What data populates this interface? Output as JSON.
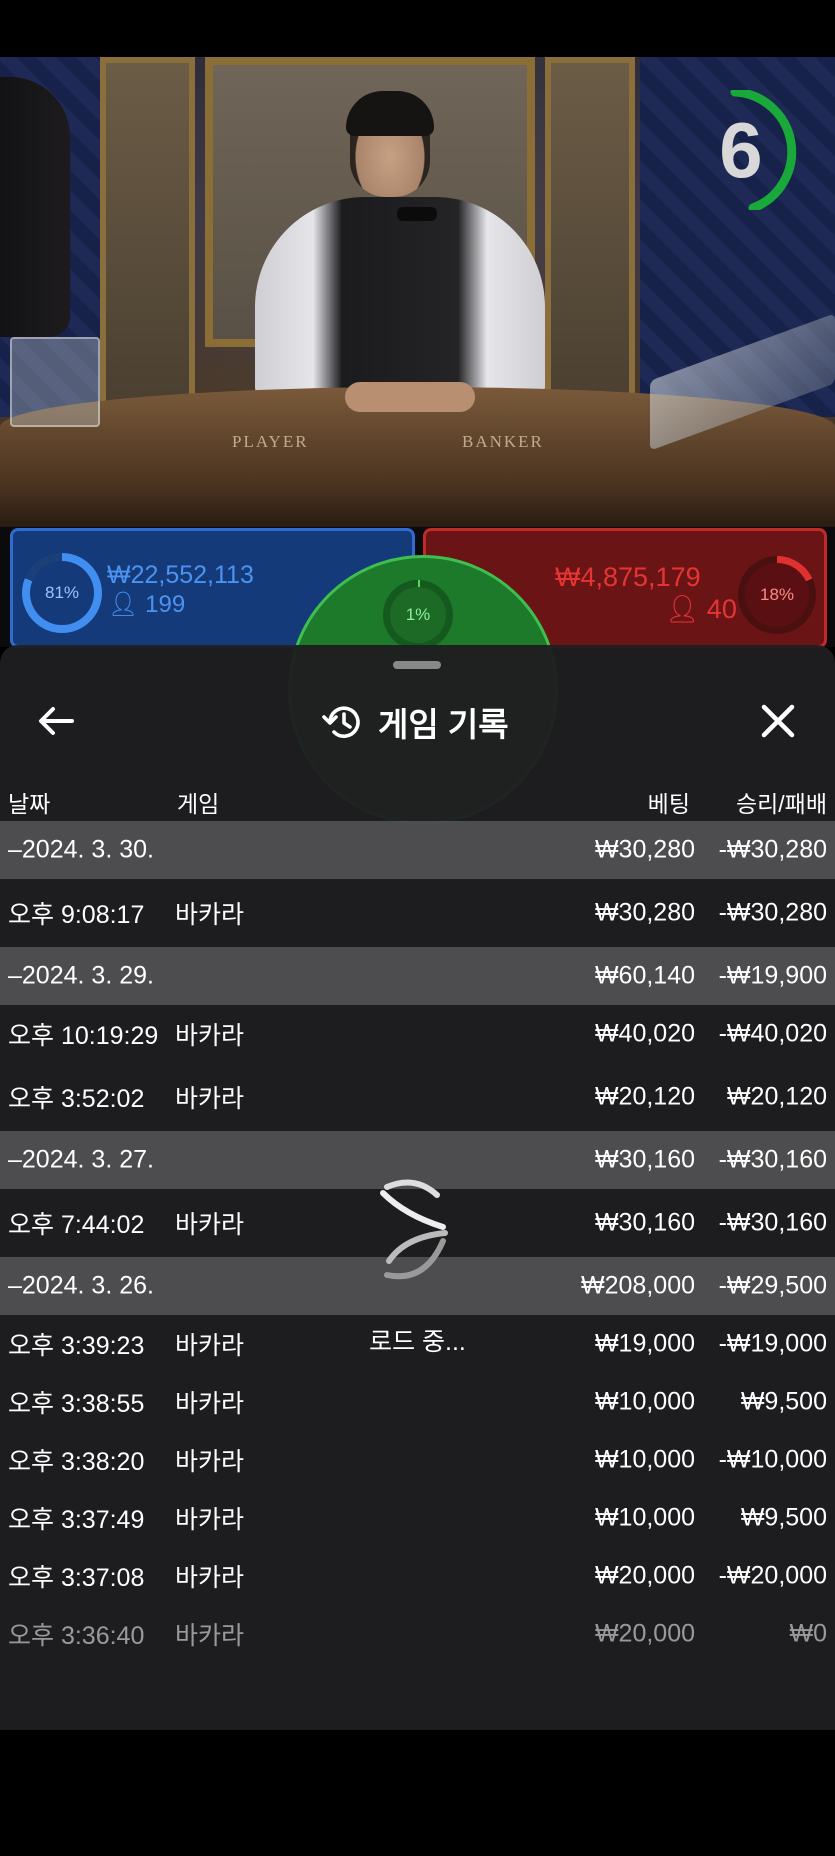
{
  "game": {
    "timer": "6",
    "table_labels": {
      "player": "PLAYER",
      "banker": "BANKER"
    }
  },
  "bets": {
    "player": {
      "percent_label": "81%",
      "percent": 81,
      "amount": "₩22,552,113",
      "players": "199"
    },
    "tie": {
      "percent_label": "1%",
      "percent": 1
    },
    "banker": {
      "percent_label": "18%",
      "percent": 18,
      "amount": "₩4,875,179",
      "players": "40"
    }
  },
  "history": {
    "title": "게임 기록",
    "columns": {
      "date": "날짜",
      "game": "게임",
      "bet": "베팅",
      "win_loss": "승리/패배"
    },
    "rows": [
      {
        "type": "date",
        "date": "–2024. 3. 30.",
        "game": "",
        "bet": "₩30,280",
        "win_loss": "-₩30,280"
      },
      {
        "type": "item",
        "date": "오후 9:08:17",
        "game": "바카라",
        "bet": "₩30,280",
        "win_loss": "-₩30,280"
      },
      {
        "type": "date",
        "date": "–2024. 3. 29.",
        "game": "",
        "bet": "₩60,140",
        "win_loss": "-₩19,900"
      },
      {
        "type": "item",
        "date": "오후 10:19:29",
        "game": "바카라",
        "bet": "₩40,020",
        "win_loss": "-₩40,020"
      },
      {
        "type": "item",
        "date": "오후 3:52:02",
        "game": "바카라",
        "bet": "₩20,120",
        "win_loss": "₩20,120"
      },
      {
        "type": "date",
        "date": "–2024. 3. 27.",
        "game": "",
        "bet": "₩30,160",
        "win_loss": "-₩30,160"
      },
      {
        "type": "item",
        "date": "오후 7:44:02",
        "game": "바카라",
        "bet": "₩30,160",
        "win_loss": "-₩30,160"
      },
      {
        "type": "date",
        "date": "–2024. 3. 26.",
        "game": "",
        "bet": "₩208,000",
        "win_loss": "-₩29,500"
      },
      {
        "type": "item",
        "date": "오후 3:39:23",
        "game": "바카라",
        "bet": "₩19,000",
        "win_loss": "-₩19,000"
      },
      {
        "type": "item",
        "date": "오후 3:38:55",
        "game": "바카라",
        "bet": "₩10,000",
        "win_loss": "₩9,500"
      },
      {
        "type": "item",
        "date": "오후 3:38:20",
        "game": "바카라",
        "bet": "₩10,000",
        "win_loss": "-₩10,000"
      },
      {
        "type": "item",
        "date": "오후 3:37:49",
        "game": "바카라",
        "bet": "₩10,000",
        "win_loss": "₩9,500"
      },
      {
        "type": "item",
        "date": "오후 3:37:08",
        "game": "바카라",
        "bet": "₩20,000",
        "win_loss": "-₩20,000"
      },
      {
        "type": "item",
        "date": "오후 3:36:40",
        "game": "바카라",
        "bet": "₩20,000",
        "win_loss": "₩0"
      }
    ]
  },
  "loading": {
    "text": "로드 중..."
  },
  "icons": {
    "back": "arrow-left-icon",
    "history": "history-clock-icon",
    "close": "close-icon",
    "user": "user-icon",
    "loading": "spinner-icon"
  }
}
